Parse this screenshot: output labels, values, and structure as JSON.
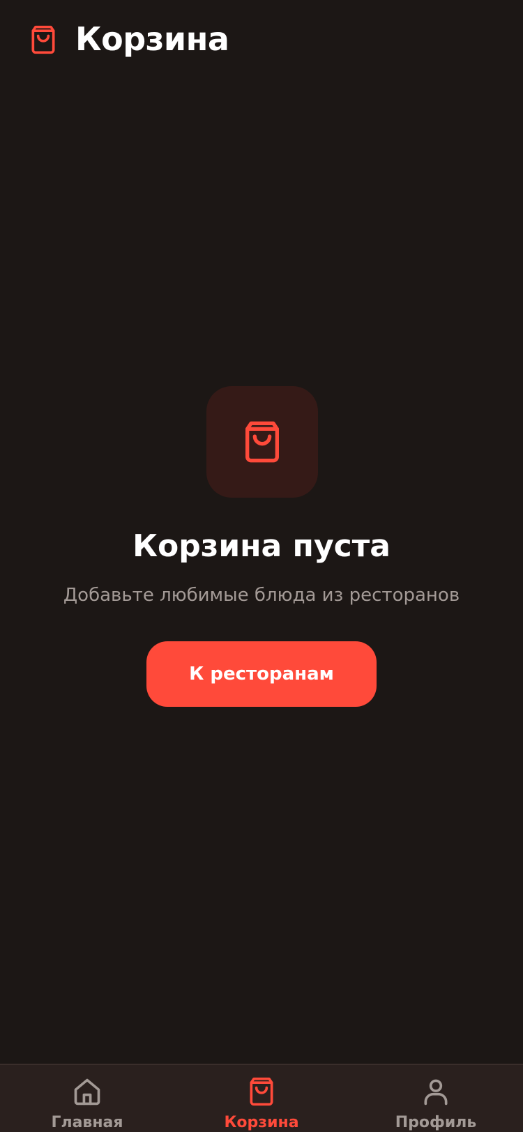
{
  "header": {
    "title": "Корзина",
    "icon": "shopping-bag-icon"
  },
  "empty_state": {
    "icon": "shopping-bag-icon",
    "title": "Корзина пуста",
    "subtitle": "Добавьте любимые блюда из ресторанов",
    "button_label": "К ресторанам"
  },
  "bottom_nav": {
    "items": [
      {
        "label": "Главная",
        "icon": "home-icon",
        "active": false
      },
      {
        "label": "Корзина",
        "icon": "shopping-bag-icon",
        "active": true
      },
      {
        "label": "Профиль",
        "icon": "user-icon",
        "active": false
      }
    ]
  },
  "colors": {
    "background": "#1c1715",
    "accent": "#ff4a3a",
    "icon_box": "#351a17",
    "nav_background": "#2a201e",
    "muted_text": "#a39a96"
  }
}
